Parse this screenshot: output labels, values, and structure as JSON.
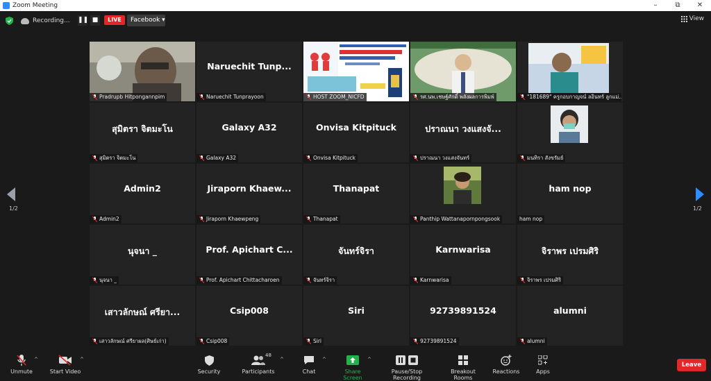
{
  "window": {
    "title": "Zoom Meeting",
    "controls": [
      "–",
      "⧉",
      "✕"
    ]
  },
  "topbar": {
    "recording_label": "Recording...",
    "pause_label": "❚❚",
    "stop_label": "■",
    "live_label": "LIVE",
    "stream_target": "Facebook ▾",
    "view_label": "View"
  },
  "pagination": {
    "prev_page": "1/2",
    "next_page": "1/2"
  },
  "participants": [
    {
      "display": "",
      "label": "Pradrupb Hitpongannpim"
    },
    {
      "display": "Naruechit Tunp...",
      "label": "Naruechit Tunprayoon"
    },
    {
      "display": "",
      "label": "HOST ZOOM_NICFD"
    },
    {
      "display": "",
      "label": "รศ.นพ.เชษฐ์ศักดิ์ พลังผลการพิมพ์"
    },
    {
      "display": "",
      "label": "\"181689\" ครูกอบกาญจน์ ลอินทร์ ลูกแม่..."
    },
    {
      "display": "สุมิตรา จิตมะโน",
      "label": "สุมิตรา จิตมะโน"
    },
    {
      "display": "Galaxy A32",
      "label": "Galaxy A32"
    },
    {
      "display": "Onvisa Kitpituck",
      "label": "Onvisa Kitpituck"
    },
    {
      "display": "ปราณนา วงแสงจั...",
      "label": "ปราณนา วงแสงจันทร์"
    },
    {
      "display": "",
      "label": "มนทิรา สังขรัมย์"
    },
    {
      "display": "Admin2",
      "label": "Admin2"
    },
    {
      "display": "Jiraporn  Khaew...",
      "label": "Jiraporn Khaewpeng"
    },
    {
      "display": "Thanapat",
      "label": "Thanapat"
    },
    {
      "display": "",
      "label": "Panthip Wattanapornpongsook"
    },
    {
      "display": "ham nop",
      "label": "ham nop"
    },
    {
      "display": "นุจนา _",
      "label": "นุจนา _"
    },
    {
      "display": "Prof. Apichart C...",
      "label": "Prof. Apichart Chittacharoen"
    },
    {
      "display": "จันทร์จิรา",
      "label": "จันทร์จิรา"
    },
    {
      "display": "Karnwarisa",
      "label": "Karnwarisa"
    },
    {
      "display": "จิราพร เปรมศิริ",
      "label": "จิราพร เปรมศิริ"
    },
    {
      "display": "เสาวลักษณ์ ศรียา...",
      "label": "เสาวลักษณ์ ศรียาผล(ศิษย์เก่า)"
    },
    {
      "display": "Csip008",
      "label": "Csip008"
    },
    {
      "display": "Siri",
      "label": "Siri"
    },
    {
      "display": "92739891524",
      "label": "92739891524"
    },
    {
      "display": "alumni",
      "label": "alumni"
    }
  ],
  "toolbar": {
    "unmute": "Unmute",
    "start_video": "Start Video",
    "security": "Security",
    "participants": "Participants",
    "participant_count": "48",
    "chat": "Chat",
    "share_screen": "Share Screen",
    "pause_stop_recording": "Pause/Stop Recording",
    "breakout_rooms": "Breakout Rooms",
    "reactions": "Reactions",
    "apps": "Apps",
    "leave": "Leave"
  },
  "colors": {
    "accent_green": "#c9e064",
    "leave_red": "#e02828",
    "share_green": "#22b24c",
    "muted_red": "#e02828"
  }
}
